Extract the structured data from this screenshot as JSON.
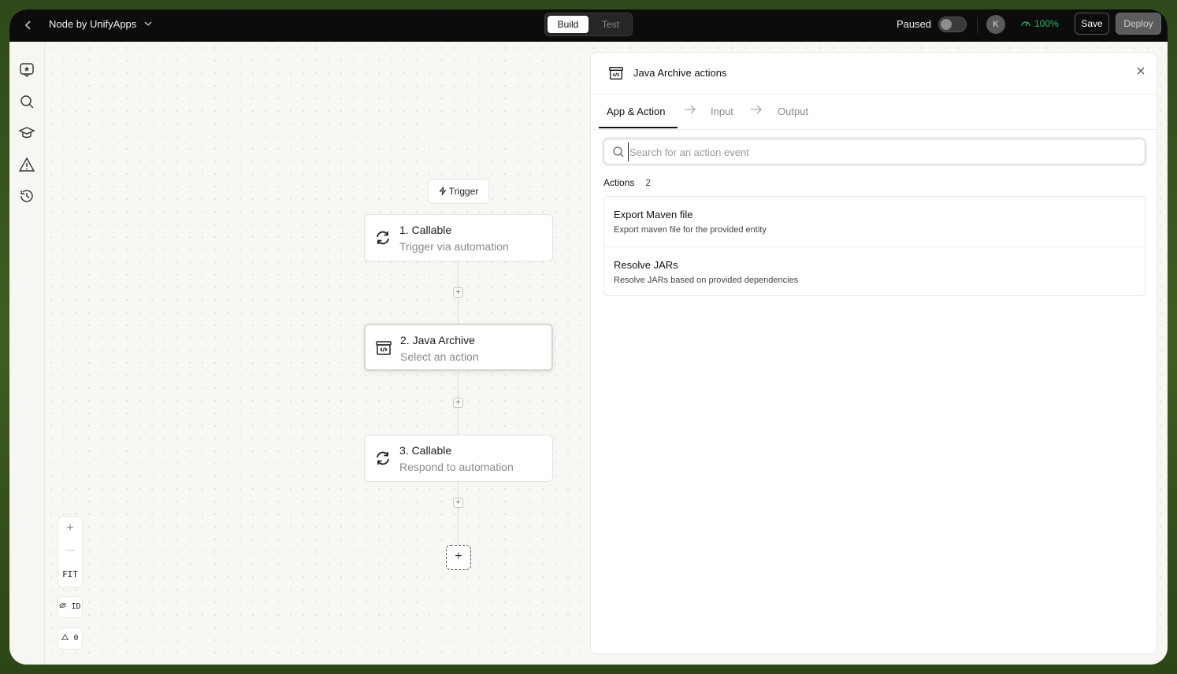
{
  "topbar": {
    "app_title": "Node by UnifyApps",
    "mode_build": "Build",
    "mode_test": "Test",
    "paused_label": "Paused",
    "avatar_initial": "K",
    "health": "100%",
    "save_label": "Save",
    "deploy_label": "Deploy"
  },
  "canvas": {
    "trigger_label": "Trigger",
    "nodes": [
      {
        "title": "1. Callable",
        "subtitle": "Trigger via automation"
      },
      {
        "title": "2. Java Archive",
        "subtitle": "Select an action"
      },
      {
        "title": "3. Callable",
        "subtitle": "Respond to automation"
      }
    ],
    "zoom": {
      "plus": "+",
      "minus": "—",
      "fit": "FIT"
    },
    "id_toggle": "ID",
    "warnings_count": "0"
  },
  "panel": {
    "title": "Java Archive actions",
    "tabs": [
      {
        "label": "App & Action",
        "active": true
      },
      {
        "label": "Input",
        "active": false
      },
      {
        "label": "Output",
        "active": false
      }
    ],
    "search_placeholder": "Search for an action event",
    "actions_label": "Actions",
    "actions_count": "2",
    "actions": [
      {
        "title": "Export Maven file",
        "description": "Export maven file for the provided entity"
      },
      {
        "title": "Resolve JARs",
        "description": "Resolve JARs based on provided dependencies"
      }
    ]
  },
  "colors": {
    "topbar_bg": "#0c0c0c",
    "health_green": "#2fb56a",
    "canvas_bg": "#f8f7f4",
    "frame_bezel": "#3f5d22"
  }
}
